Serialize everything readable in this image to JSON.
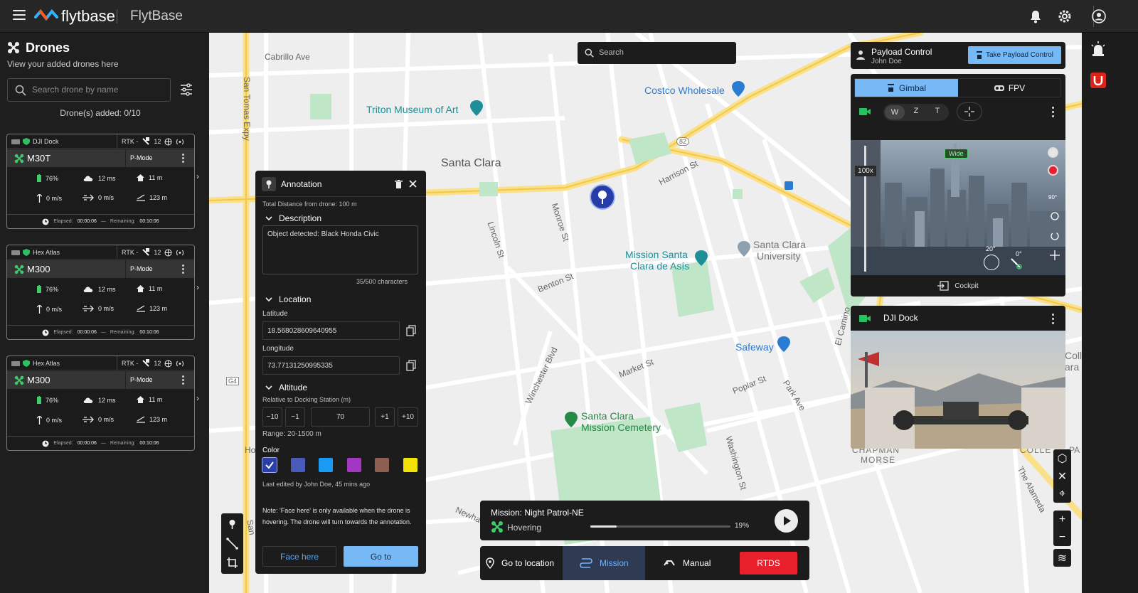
{
  "app": {
    "brand": "flytbase",
    "title": "FlytBase"
  },
  "sidebar": {
    "title": "Drones",
    "subtitle": "View your added drones here",
    "search_placeholder": "Search drone by name",
    "count_text": "Drone(s) added: 0/10",
    "cards": [
      {
        "dock": "DJI Dock",
        "rtk": "RTK -",
        "sat": "12",
        "name": "M30T",
        "mode": "P-Mode",
        "battery": "76%",
        "latency": "12 ms",
        "height": "11 m",
        "vspeed": "0 m/s",
        "hspeed": "0 m/s",
        "distance": "123 m",
        "elapsed_label": "Elapsed:",
        "elapsed": "00:00:06",
        "remaining_label": "Remaining:",
        "remaining": "00:10:06"
      },
      {
        "dock": "Hex Atlas",
        "rtk": "RTK -",
        "sat": "12",
        "name": "M300",
        "mode": "P-Mode",
        "battery": "76%",
        "latency": "12 ms",
        "height": "11 m",
        "vspeed": "0 m/s",
        "hspeed": "0 m/s",
        "distance": "123 m",
        "elapsed_label": "Elapsed:",
        "elapsed": "00:00:06",
        "remaining_label": "Remaining:",
        "remaining": "00:10:06"
      },
      {
        "dock": "Hex Atlas",
        "rtk": "RTK -",
        "sat": "12",
        "name": "M300",
        "mode": "P-Mode",
        "battery": "76%",
        "latency": "12 ms",
        "height": "11 m",
        "vspeed": "0 m/s",
        "hspeed": "0 m/s",
        "distance": "123 m",
        "elapsed_label": "Elapsed:",
        "elapsed": "00:00:06",
        "remaining_label": "Remaining:",
        "remaining": "00:10:06"
      }
    ]
  },
  "map": {
    "search_placeholder": "Search",
    "labels": {
      "cabrillo": "Cabrillo Ave",
      "san_tomas": "San Tomas Expy",
      "santa_clara": "Santa Clara",
      "triton": "Triton Museum of Art",
      "costco": "Costco Wholesale",
      "harrison": "Harrison St",
      "monroe": "Monroe St",
      "lincoln": "Lincoln St",
      "benton": "Benton St",
      "mission_santa": "Mission Santa",
      "clara_de_asis": "Clara de Asís",
      "scu_1": "Santa Clara",
      "scu_2": "University",
      "el_camino": "El Camino",
      "safeway": "Safeway",
      "market": "Market St",
      "poplar": "Poplar St",
      "park": "Park Ave",
      "winchester": "Winchester Blvd",
      "cemetery_1": "Santa Clara",
      "cemetery_2": "Mission Cemetery",
      "washington": "Washington St",
      "newhall": "Newha",
      "g4": "G4",
      "r82": "82",
      "alameda": "The Alameda",
      "coll": "Coll",
      "ara": "ara",
      "colle": "COLLE",
      "pa": "PA",
      "chapman": "CHAPMAN",
      "morse": "MORSE",
      "hol": "Ho",
      "san_short": "San"
    }
  },
  "annotation": {
    "title": "Annotation",
    "distance": "Total Distance from drone: 100 m",
    "description_label": "Description",
    "description_value": "Object detected: Black Honda Civic",
    "char_count": "35/500 characters",
    "location_label": "Location",
    "latitude_label": "Latitude",
    "latitude": "18.568028609640955",
    "longitude_label": "Longitude",
    "longitude": "73.77131250995335",
    "altitude_label": "Altitude",
    "altitude_sub": "Relative to Docking Station (m)",
    "steps": [
      "−10",
      "−1",
      "+1",
      "+10"
    ],
    "altitude_value": "70",
    "range": "Range: 20-1500 m",
    "color_label": "Color",
    "colors": [
      "#2c3ea8",
      "#4a5ab8",
      "#1a9af2",
      "#a437c2",
      "#8d5e52",
      "#f3e300"
    ],
    "last_edited": "Last edited by John Doe, 45 mins ago",
    "note": "Note: 'Face here' is only available when the drone is hovering. The drone will turn towards the annotation.",
    "face_here": "Face here",
    "go_to": "Go to"
  },
  "mission": {
    "title": "Mission: Night Patrol-NE",
    "status": "Hovering",
    "progress": 19,
    "progress_text": "19%"
  },
  "modes": {
    "goto": "Go to location",
    "mission": "Mission",
    "manual": "Manual",
    "rtds": "RTDS"
  },
  "payload": {
    "title": "Payload Control",
    "user": "John Doe",
    "take": "Take Payload Control"
  },
  "gimbal": {
    "tab_gimbal": "Gimbal",
    "tab_fpv": "FPV",
    "zoom": [
      "W",
      "Z",
      "T"
    ],
    "zoom_level": "100x",
    "wide_badge": "Wide",
    "pitch": "90°",
    "angle_a": "20°",
    "angle_b": "0°",
    "cockpit": "Cockpit"
  },
  "dock": {
    "title": "DJI Dock"
  }
}
